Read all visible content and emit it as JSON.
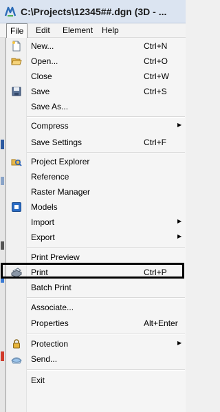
{
  "window": {
    "title": "C:\\Projects\\12345##.dgn (3D - ..."
  },
  "menubar": {
    "items": [
      "File",
      "Edit",
      "Element",
      "Help"
    ]
  },
  "file_menu": {
    "items": [
      {
        "label": "New...",
        "shortcut": "Ctrl+N",
        "icon": "new-file-icon"
      },
      {
        "label": "Open...",
        "shortcut": "Ctrl+O",
        "icon": "open-folder-icon"
      },
      {
        "label": "Close",
        "shortcut": "Ctrl+W"
      },
      {
        "label": "Save",
        "shortcut": "Ctrl+S",
        "icon": "save-disk-icon"
      },
      {
        "label": "Save As..."
      },
      {
        "label": "Compress",
        "submenu": true
      },
      {
        "label": "Save Settings",
        "shortcut": "Ctrl+F"
      },
      {
        "label": "Project Explorer",
        "icon": "project-explorer-icon"
      },
      {
        "label": "Reference"
      },
      {
        "label": "Raster Manager"
      },
      {
        "label": "Models",
        "icon": "models-icon"
      },
      {
        "label": "Import",
        "submenu": true
      },
      {
        "label": "Export",
        "submenu": true
      },
      {
        "label": "Print Preview"
      },
      {
        "label": "Print",
        "shortcut": "Ctrl+P",
        "icon": "printer-icon"
      },
      {
        "label": "Batch Print"
      },
      {
        "label": "Associate..."
      },
      {
        "label": "Properties",
        "shortcut": "Alt+Enter"
      },
      {
        "label": "Protection",
        "submenu": true,
        "icon": "padlock-icon"
      },
      {
        "label": "Send...",
        "icon": "send-icon"
      },
      {
        "label": "Exit"
      }
    ]
  }
}
